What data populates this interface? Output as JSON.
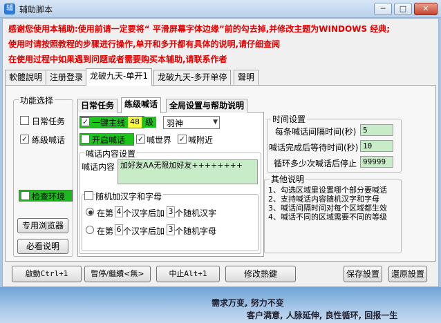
{
  "window": {
    "title": "辅助脚本",
    "controls": [
      "─",
      "□",
      "✕"
    ]
  },
  "notices": [
    "感谢您使用本辅助:使用前请一定要将“ 平滑屏幕字体边缘”前的勾去掉,并修改主题为WINDOWS 经典;",
    "使用时请按照教程的步骤进行操作,单开和多开都有具体的说明,请仔细查阅",
    "在使用过程中如果遇到问题或者需要购买本辅助,请联系作者"
  ],
  "tabs": [
    "軟體說明",
    "注册登录",
    "龙破九天-单开1",
    "龙破九天-多开单停",
    "聲明"
  ],
  "function_group": {
    "title": "功能选择",
    "items": [
      {
        "label": "日常任务",
        "checked": false
      },
      {
        "label": "练级喊话",
        "checked": true
      }
    ],
    "check_env": "检查环境",
    "browser_button": "专用浏览器",
    "help_button": "必看说明"
  },
  "subtabs": [
    "日常任务",
    "练级喊话",
    "全局设置与帮助说明"
  ],
  "shout": {
    "main_line_label": "一键主线",
    "level": "48",
    "level_unit": "级",
    "profession": "羽神",
    "open_shout": "开启喊话",
    "shout_world": "喊世界",
    "shout_nearby": "喊附近",
    "content_group_title": "喊话内容设置",
    "content_label": "喊话内容",
    "content_value": "加好友AA无限加好友++++++++",
    "random_label": "随机加汉字和字母",
    "rule1": {
      "prefix": "在第",
      "pos": "4",
      "mid": "个汉字后加",
      "count": "3",
      "suffix": "个随机汉字"
    },
    "rule2": {
      "prefix": "在第",
      "pos": "6",
      "mid": "个汉字后加",
      "count": "3",
      "suffix": "个随机字母"
    }
  },
  "time_settings": {
    "title": "时间设置",
    "rows": [
      {
        "label": "每条喊话间隔时间(秒)",
        "value": "5"
      },
      {
        "label": "喊话完成后等待时间(秒)",
        "value": "10"
      },
      {
        "label": "循环多少次喊话后停止",
        "value": "99999"
      }
    ]
  },
  "other_notes": {
    "title": "其他说明",
    "lines": [
      "1、勾选区域里设置哪个部分要喊话",
      "2、支持喊话内容随机汉字和字母",
      "3、喊话间隔时间对每个区域都生效",
      "4、喊话不同的区域需要不同的等级"
    ]
  },
  "bottom_buttons": {
    "start": "啟動Ctrl+1",
    "pause": "暫停/繼續<無>",
    "stop": "中止Alt+1",
    "hotkey": "修改熱鍵",
    "save": "保存設置",
    "restore": "還原設置"
  },
  "footer": {
    "line1": "需求万变, 努力不变",
    "line2": "客户满意, 人脉延伸, 良性循环, 回报一生"
  }
}
